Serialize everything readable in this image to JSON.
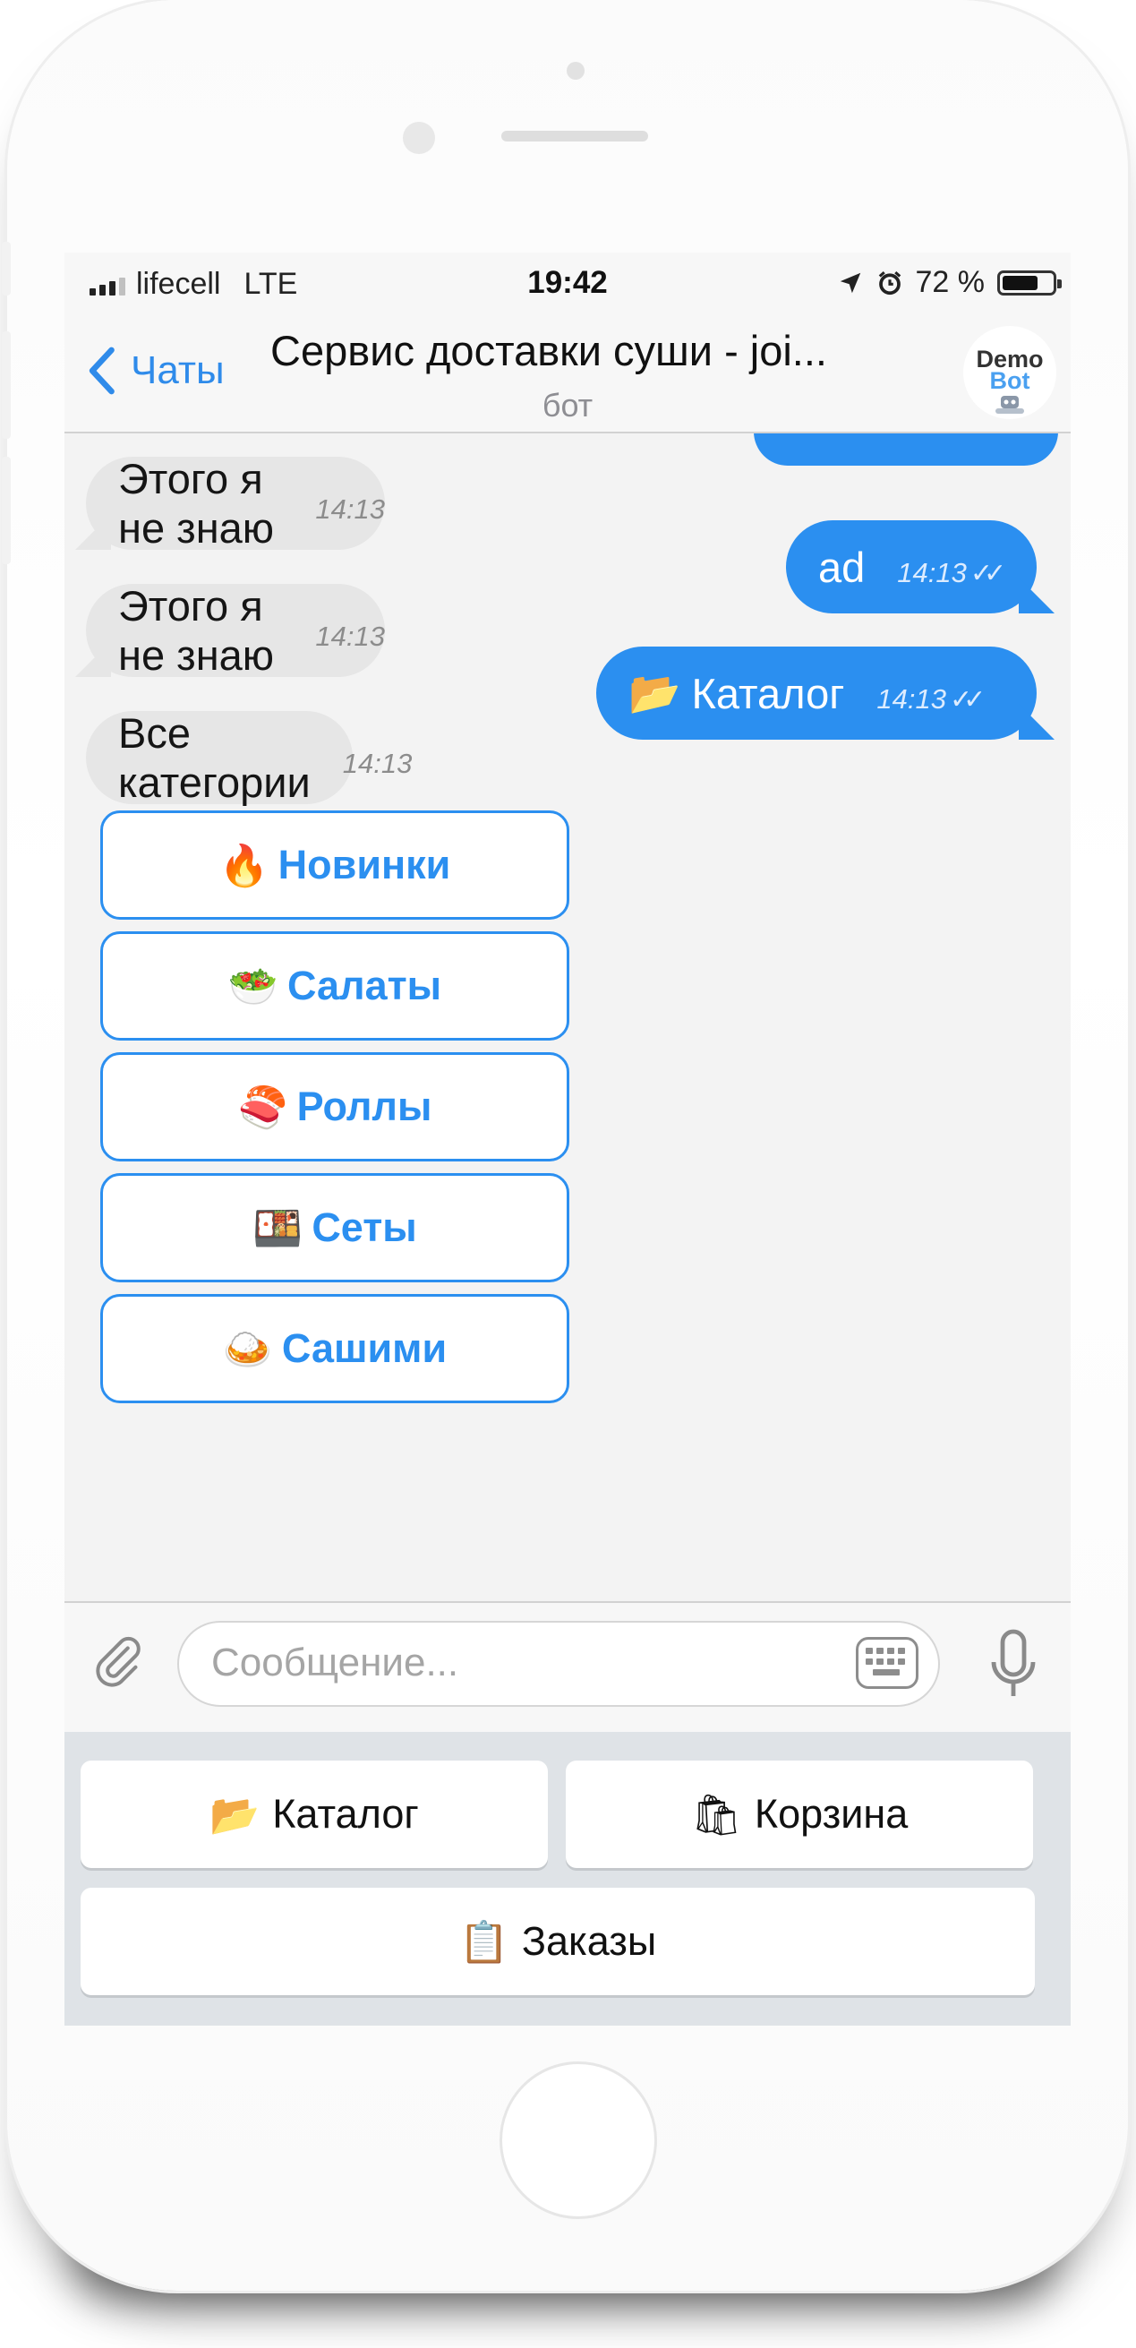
{
  "status_bar": {
    "carrier": "lifecell",
    "network": "LTE",
    "time": "19:42",
    "battery_text": "72 %",
    "battery_level": 0.72,
    "icons": [
      "location-arrow-icon",
      "alarm-icon",
      "battery-icon"
    ]
  },
  "header": {
    "back_label": "Чаты",
    "title": "Сервис доставки суши - joi...",
    "subtitle": "бот",
    "avatar_line1": "Demo",
    "avatar_line2": "Bot"
  },
  "messages": [
    {
      "direction": "in",
      "text": "Этого я не знаю",
      "time": "14:13"
    },
    {
      "direction": "out",
      "text": "ad",
      "time": "14:13",
      "status": "read"
    },
    {
      "direction": "in",
      "text": "Этого я не знаю",
      "time": "14:13"
    },
    {
      "direction": "out",
      "emoji": "📂",
      "text": "Каталог",
      "time": "14:13",
      "status": "read"
    },
    {
      "direction": "in",
      "text": "Все категории",
      "time": "14:13"
    }
  ],
  "inline_keyboard": [
    {
      "emoji": "🔥",
      "label": "Новинки"
    },
    {
      "emoji": "🥗",
      "label": "Салаты"
    },
    {
      "emoji": "🍣",
      "label": "Роллы"
    },
    {
      "emoji": "🍱",
      "label": "Сеты"
    },
    {
      "emoji": "🍛",
      "label": "Сашими"
    }
  ],
  "input": {
    "placeholder": "Сообщение...",
    "icons": [
      "paperclip-icon",
      "keyboard-icon",
      "microphone-icon"
    ]
  },
  "reply_keyboard": {
    "catalog": {
      "emoji": "📂",
      "label": "Каталог"
    },
    "cart": {
      "emoji": "🛍",
      "label": "Корзина"
    },
    "orders": {
      "emoji": "📋",
      "label": "Заказы"
    }
  },
  "colors": {
    "accent": "#2b8ff0",
    "incoming_bubble": "#e6e6e6",
    "chat_background": "#f3f3f3"
  }
}
